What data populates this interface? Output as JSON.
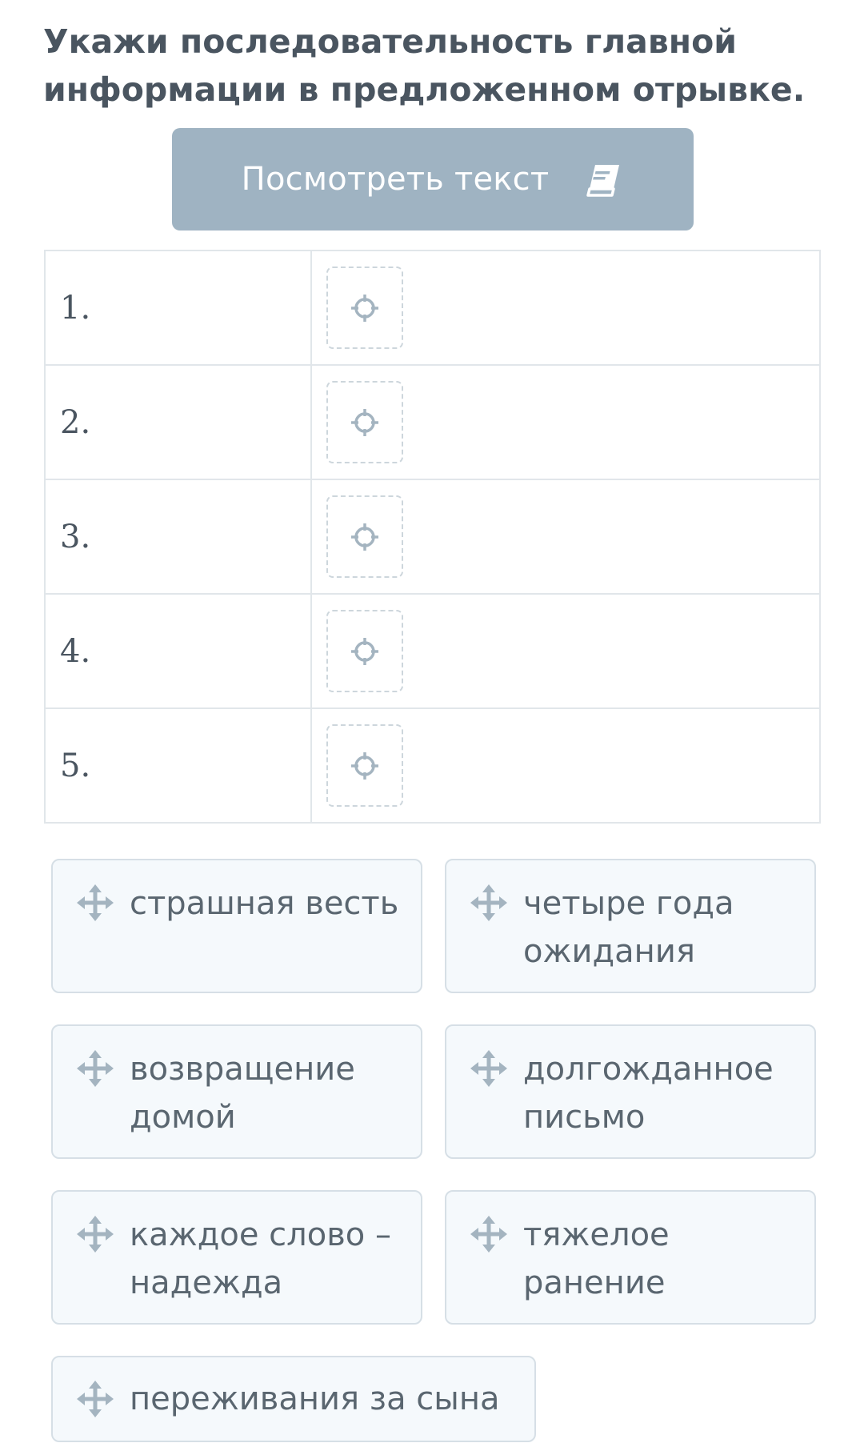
{
  "task": {
    "instruction": "Укажи последовательность главной информации в предложенном отрывке."
  },
  "view_text_button": {
    "label": "Посмотреть текст",
    "icon": "book-icon"
  },
  "answer_table": {
    "rows": [
      {
        "number": "1."
      },
      {
        "number": "2."
      },
      {
        "number": "3."
      },
      {
        "number": "4."
      },
      {
        "number": "5."
      }
    ],
    "slot_icon": "target-icon"
  },
  "options": {
    "drag_icon": "move-icon",
    "items": [
      {
        "label": "страшная весть"
      },
      {
        "label": "четыре года ожидания"
      },
      {
        "label": "возвращение домой"
      },
      {
        "label": "долгожданное письмо"
      },
      {
        "label": "каждое слово – надежда"
      },
      {
        "label": "тяжелое ранение"
      },
      {
        "label": "переживания за сына"
      }
    ]
  },
  "colors": {
    "button_bg": "#9fb3c2",
    "chip_bg": "#f5f9fc",
    "chip_border": "#d6dfe6",
    "icon": "#a4b4c0",
    "text": "#4a5560"
  }
}
